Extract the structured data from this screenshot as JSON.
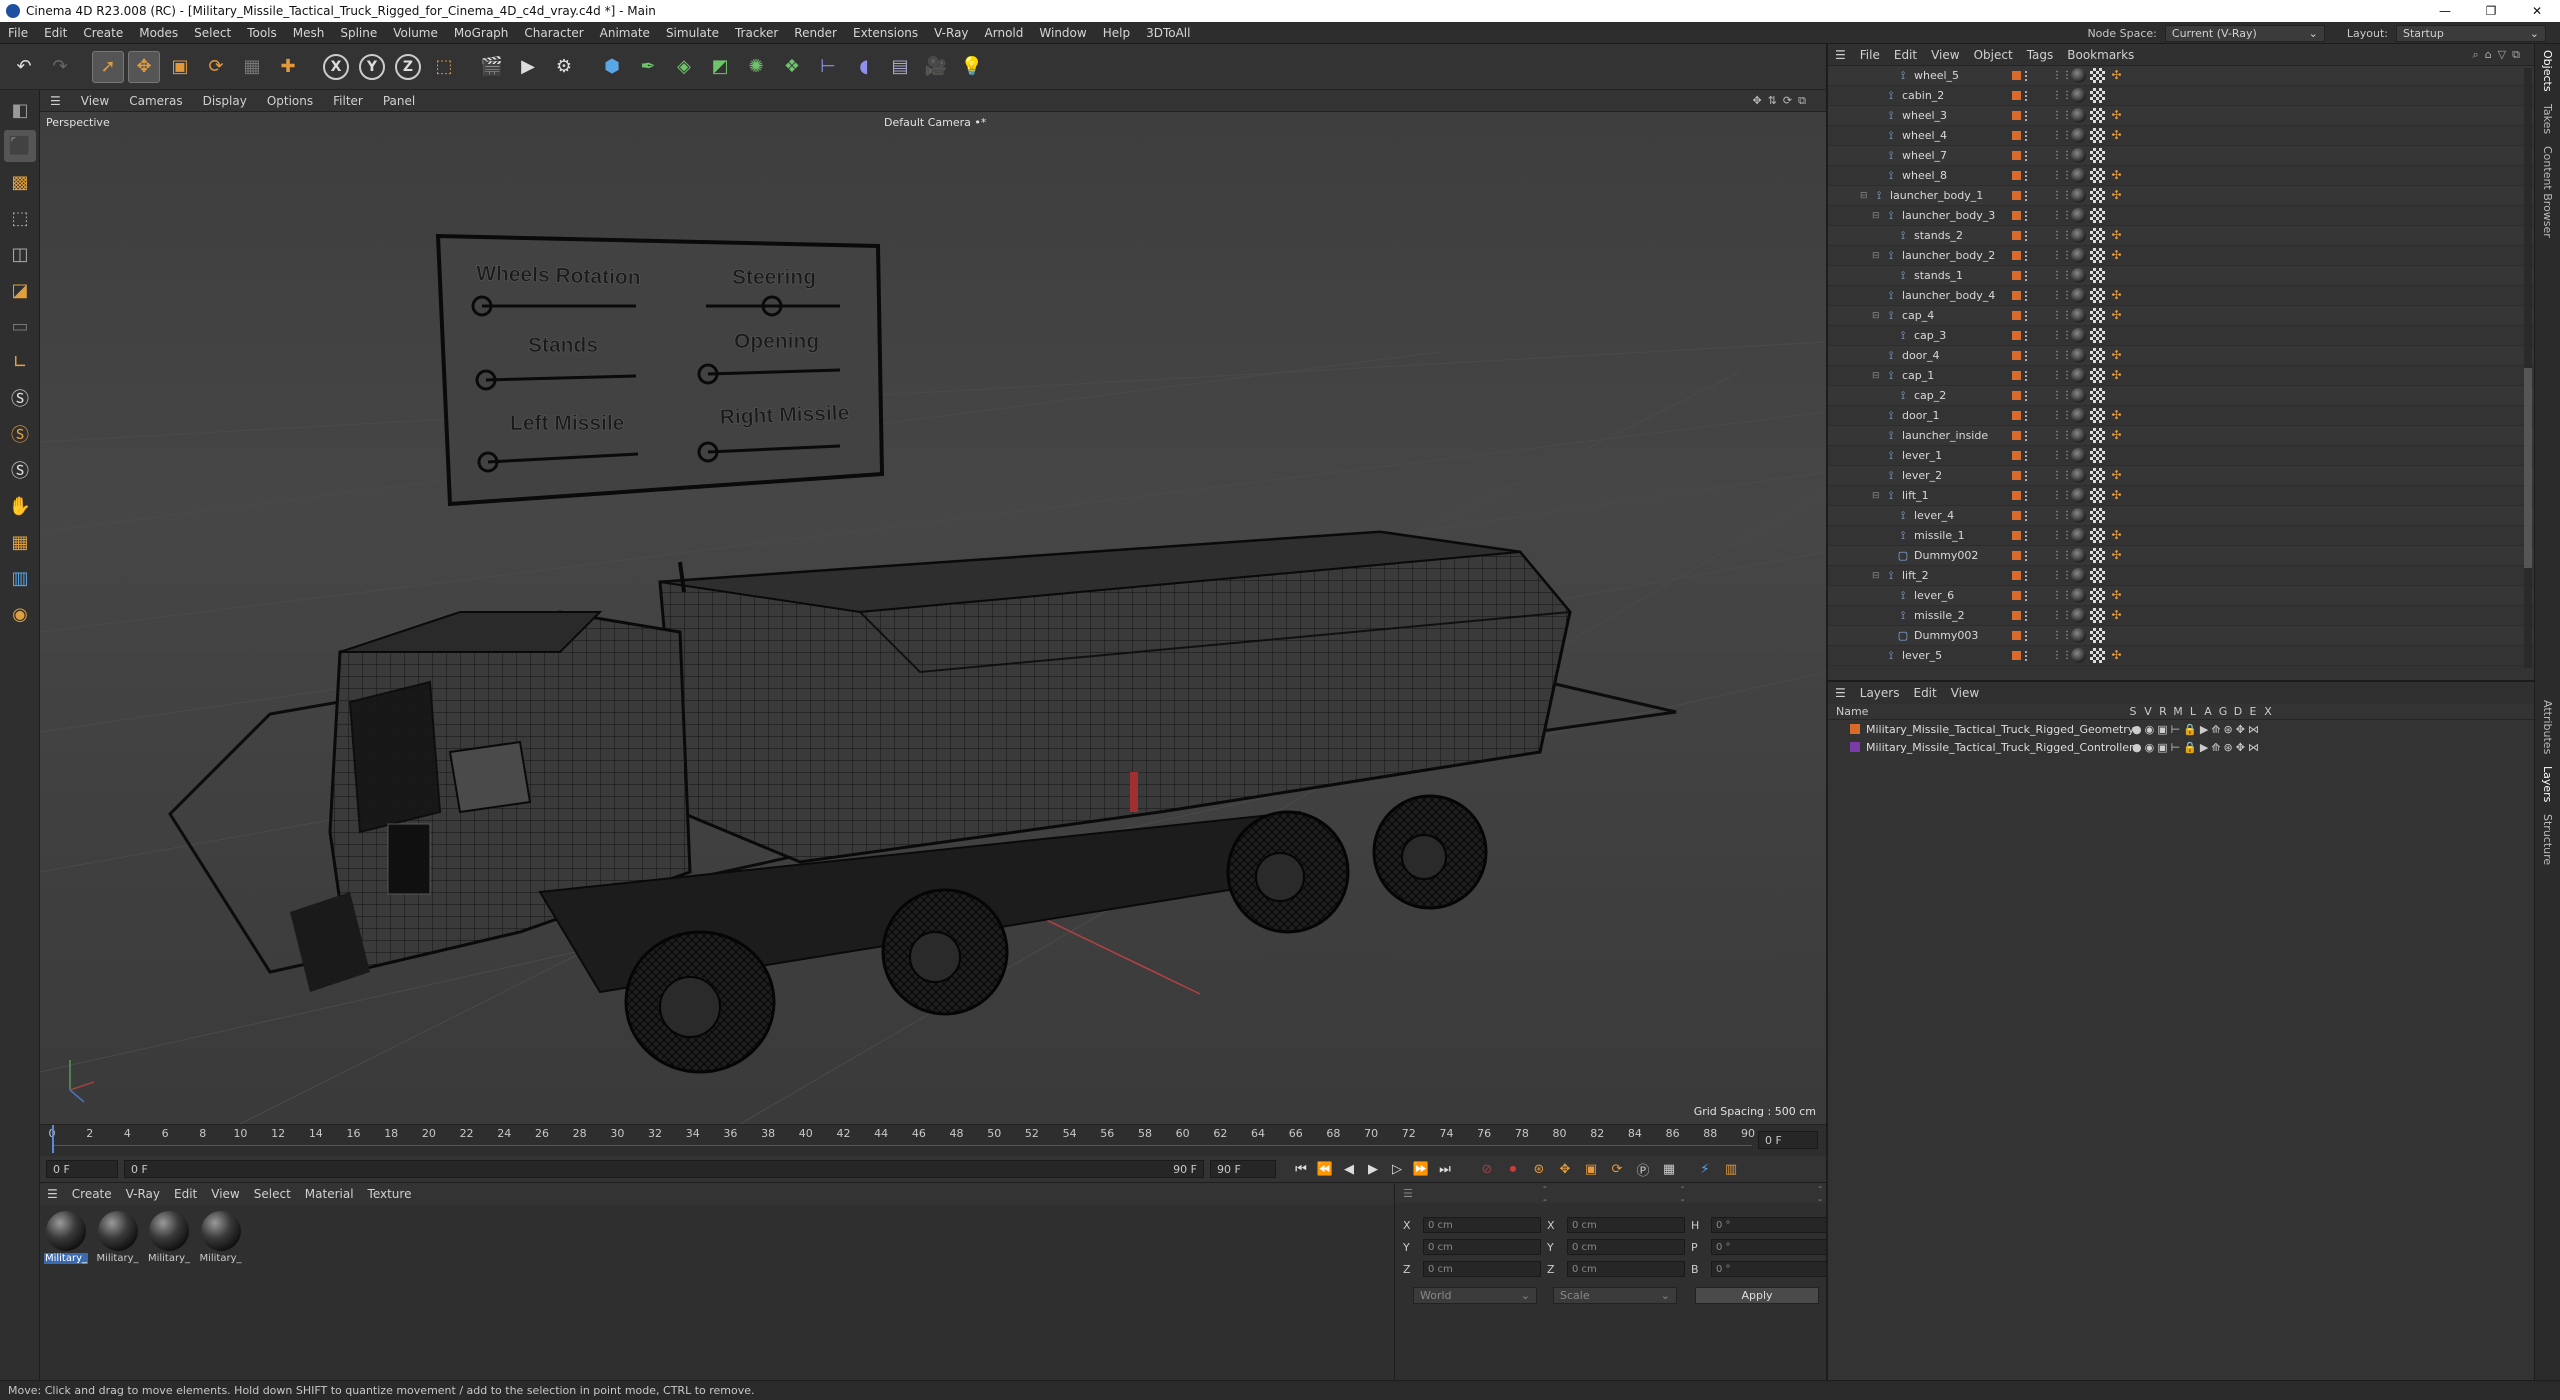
{
  "window": {
    "title": "Cinema 4D R23.008 (RC) - [Military_Missile_Tactical_Truck_Rigged_for_Cinema_4D_c4d_vray.c4d *] - Main",
    "controls": [
      "—",
      "❐",
      "✕"
    ]
  },
  "menubar": {
    "items": [
      "File",
      "Edit",
      "Create",
      "Modes",
      "Select",
      "Tools",
      "Mesh",
      "Spline",
      "Volume",
      "MoGraph",
      "Character",
      "Animate",
      "Simulate",
      "Tracker",
      "Render",
      "Extensions",
      "V-Ray",
      "Arnold",
      "Window",
      "Help",
      "3DToAll"
    ],
    "node_space_label": "Node Space:",
    "node_space_value": "Current (V-Ray)",
    "layout_label": "Layout:",
    "layout_value": "Startup"
  },
  "viewport": {
    "menu": [
      "View",
      "Cameras",
      "Display",
      "Options",
      "Filter",
      "Panel"
    ],
    "name": "Perspective",
    "camera": "Default Camera •*",
    "grid_spacing": "Grid Spacing : 500 cm",
    "control_board": {
      "wheels_rotation": "Wheels Rotation",
      "steering": "Steering",
      "stands": "Stands",
      "opening": "Opening",
      "left_missile": "Left Missile",
      "right_missile": "Right Missile"
    }
  },
  "timeline": {
    "ticks": [
      "0",
      "2",
      "4",
      "6",
      "8",
      "10",
      "12",
      "14",
      "16",
      "18",
      "20",
      "22",
      "24",
      "26",
      "28",
      "30",
      "32",
      "34",
      "36",
      "38",
      "40",
      "42",
      "44",
      "46",
      "48",
      "50",
      "52",
      "54",
      "56",
      "58",
      "60",
      "62",
      "64",
      "66",
      "68",
      "70",
      "72",
      "74",
      "76",
      "78",
      "80",
      "82",
      "84",
      "86",
      "88",
      "90"
    ],
    "current_frame_box": "0 F",
    "start": "0 F",
    "range_start": "0 F",
    "range_end": "90 F",
    "end": "90 F"
  },
  "materials": {
    "menu": [
      "Create",
      "V-Ray",
      "Edit",
      "View",
      "Select",
      "Material",
      "Texture"
    ],
    "items": [
      "Military_",
      "Military_",
      "Military_",
      "Military_"
    ]
  },
  "coords": {
    "rows": [
      {
        "a": "X",
        "v1": "0 cm",
        "b": "X",
        "v2": "0 cm",
        "c": "H",
        "v3": "0 °"
      },
      {
        "a": "Y",
        "v1": "0 cm",
        "b": "Y",
        "v2": "0 cm",
        "c": "P",
        "v3": "0 °"
      },
      {
        "a": "Z",
        "v1": "0 cm",
        "b": "Z",
        "v2": "0 cm",
        "c": "B",
        "v3": "0 °"
      }
    ],
    "mode1": "World",
    "mode2": "Scale",
    "apply": "Apply",
    "header_dashes": [
      "--",
      "--",
      "--"
    ]
  },
  "status": "Move: Click and drag to move elements. Hold down SHIFT to quantize movement / add to the selection in point mode, CTRL to remove.",
  "objects": {
    "menu": [
      "File",
      "Edit",
      "View",
      "Object",
      "Tags",
      "Bookmarks"
    ],
    "rows": [
      {
        "name": "wheel_5",
        "indent": 3
      },
      {
        "name": "cabin_2",
        "indent": 2
      },
      {
        "name": "wheel_3",
        "indent": 2
      },
      {
        "name": "wheel_4",
        "indent": 2
      },
      {
        "name": "wheel_7",
        "indent": 2
      },
      {
        "name": "wheel_8",
        "indent": 2
      },
      {
        "name": "launcher_body_1",
        "indent": 1
      },
      {
        "name": "launcher_body_3",
        "indent": 2
      },
      {
        "name": "stands_2",
        "indent": 3
      },
      {
        "name": "launcher_body_2",
        "indent": 2
      },
      {
        "name": "stands_1",
        "indent": 3
      },
      {
        "name": "launcher_body_4",
        "indent": 2
      },
      {
        "name": "cap_4",
        "indent": 2
      },
      {
        "name": "cap_3",
        "indent": 3
      },
      {
        "name": "door_4",
        "indent": 2
      },
      {
        "name": "cap_1",
        "indent": 2
      },
      {
        "name": "cap_2",
        "indent": 3
      },
      {
        "name": "door_1",
        "indent": 2
      },
      {
        "name": "launcher_inside",
        "indent": 2
      },
      {
        "name": "lever_1",
        "indent": 2
      },
      {
        "name": "lever_2",
        "indent": 2
      },
      {
        "name": "lift_1",
        "indent": 2
      },
      {
        "name": "lever_4",
        "indent": 3
      },
      {
        "name": "missile_1",
        "indent": 3
      },
      {
        "name": "Dummy002",
        "indent": 3
      },
      {
        "name": "lift_2",
        "indent": 2
      },
      {
        "name": "lever_6",
        "indent": 3
      },
      {
        "name": "missile_2",
        "indent": 3
      },
      {
        "name": "Dummy003",
        "indent": 3
      },
      {
        "name": "lever_5",
        "indent": 2
      }
    ]
  },
  "layers": {
    "menu": [
      "Layers",
      "Edit",
      "View"
    ],
    "header": {
      "name": "Name",
      "flags": [
        "S",
        "V",
        "R",
        "M",
        "L",
        "A",
        "G",
        "D",
        "E",
        "X"
      ]
    },
    "rows": [
      {
        "name": "Military_Missile_Tactical_Truck_Rigged_Geometry",
        "color": "#d86a2a"
      },
      {
        "name": "Military_Missile_Tactical_Truck_Rigged_Controllers",
        "color": "#7a3aa8"
      }
    ]
  },
  "right_dock_tabs": [
    "Objects",
    "Takes",
    "Content Browser",
    "Attributes",
    "Layers",
    "Structure"
  ],
  "colors": {
    "accent": "#e29a3c",
    "selection": "#3a6ab0"
  }
}
